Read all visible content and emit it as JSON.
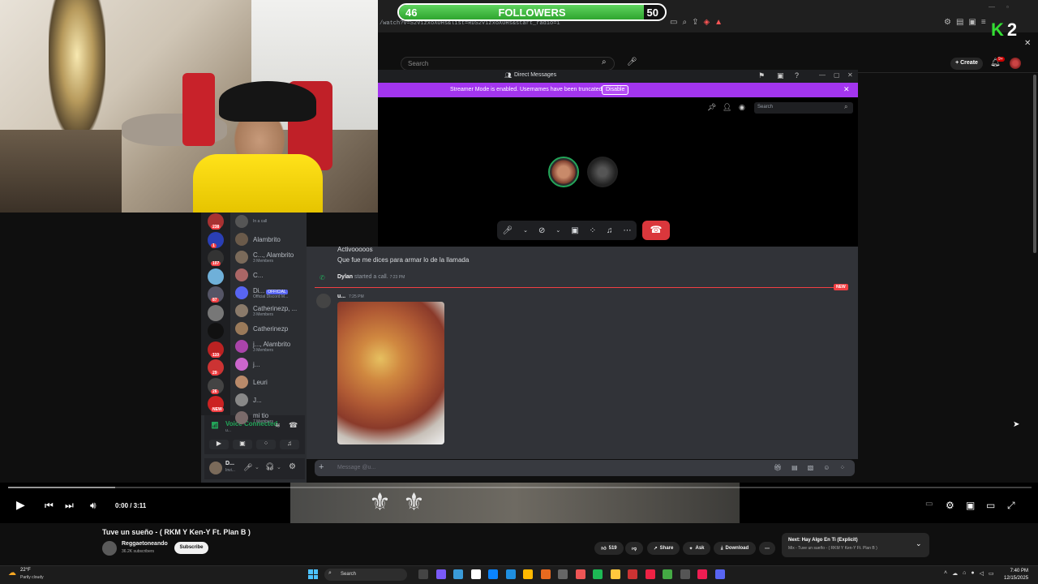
{
  "overlay": {
    "followers_label": "FOLLOWERS",
    "followers_current": "46",
    "followers_goal": "50",
    "followers_progress_fraction": 0.92,
    "logo_letter": "K",
    "logo_number": "2",
    "accent_green": "#33dd33"
  },
  "browser": {
    "url": "/watch?v=S2V1zxoXOHs&list=RDS2V1zxoXOHs&start_radio=1"
  },
  "youtube_header": {
    "search_placeholder": "Search",
    "create_label": "Create",
    "notification_count": "9+"
  },
  "discord": {
    "window_title": "Direct Messages",
    "streamer_notice": "Streamer Mode is enabled. Usernames have been truncated.",
    "disable_label": "Disable",
    "search_placeholder": "Search",
    "server_badges": [
      "238",
      "1",
      "107",
      "",
      "87",
      "",
      "",
      "110",
      "29",
      "26",
      "NEW"
    ],
    "dm_list": [
      {
        "name": "",
        "sub": "In a call"
      },
      {
        "name": "Alambrito",
        "sub": ""
      },
      {
        "name": "C..., Alambrito",
        "sub": "3 Members"
      },
      {
        "name": "C...",
        "sub": ""
      },
      {
        "name": "Di...",
        "sub": "Official Discord M...",
        "tag": "OFFICIAL"
      },
      {
        "name": "Catherinezp, ...",
        "sub": "3 Members"
      },
      {
        "name": "Catherinezp",
        "sub": ""
      },
      {
        "name": "j..., Alambrito",
        "sub": "3 Members"
      },
      {
        "name": "j...",
        "sub": ""
      },
      {
        "name": "Leuri",
        "sub": ""
      },
      {
        "name": "J...",
        "sub": ""
      },
      {
        "name": "mi tio",
        "sub": "7 Members"
      }
    ],
    "voice_connected": "Voice Connected",
    "voice_sub": "u...",
    "user_name": "D...",
    "user_status": "Invi...",
    "messages": {
      "line1": "Activooooos",
      "line2": "Que fue me dices para armar lo de la llamada",
      "call_author": "Dylan",
      "call_text": "started a call.",
      "call_time": "7:23 PM",
      "new_label": "NEW",
      "img_author": "u...",
      "img_time": "7:25 PM"
    },
    "input_placeholder": "Message @u..."
  },
  "player": {
    "time": "0:00 / 3:11",
    "progress_fraction": 0.0
  },
  "video": {
    "title": "Tuve un sueño - ( RKM Y Ken-Y Ft. Plan B )",
    "channel": "Reggaetoneando",
    "subscribers": "36.2K subscribers",
    "subscribe_label": "Subscribe",
    "likes": "519",
    "share_label": "Share",
    "ask_label": "Ask",
    "download_label": "Download",
    "next_label": "Next: Hay Algo En Ti (Explicit)",
    "next_sub": "Mix - Tuve un sueño - ( RKM Y Ken-Y Ft. Plan B )"
  },
  "taskbar": {
    "temperature": "22°F",
    "weather": "Partly cloudy",
    "search_label": "Search",
    "time": "7:40 PM",
    "date": "12/15/2025"
  }
}
